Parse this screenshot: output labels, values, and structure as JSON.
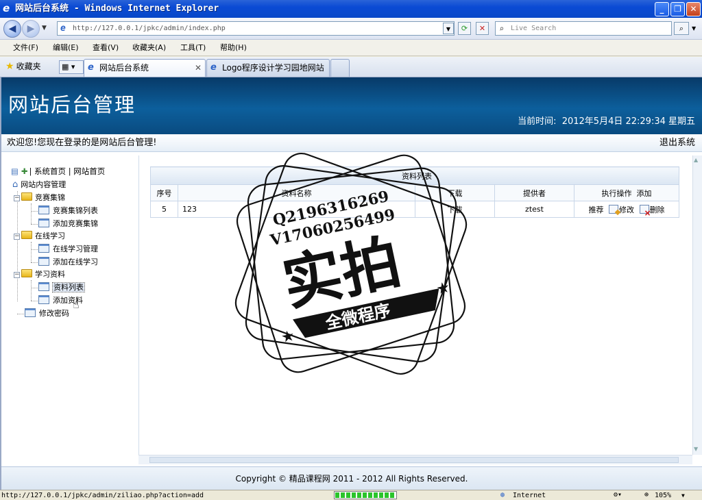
{
  "window": {
    "title": "网站后台系统 - Windows Internet Explorer",
    "controls": {
      "minimize": "_",
      "maximize": "❐",
      "close": "✕"
    }
  },
  "address_bar": {
    "url": "http://127.0.0.1/jpkc/admin/index.php",
    "search_placeholder": "Live Search"
  },
  "menu": [
    "文件(F)",
    "编辑(E)",
    "查看(V)",
    "收藏夹(A)",
    "工具(T)",
    "帮助(H)"
  ],
  "tabs": {
    "favorites_label": "收藏夹",
    "items": [
      {
        "label": "网站后台系统",
        "active": true
      },
      {
        "label": "Logo程序设计学习园地网站",
        "active": false
      }
    ]
  },
  "page": {
    "site_title": "网站后台管理",
    "time_label": "当前时间:",
    "time_value": "2012年5月4日 22:29:34 星期五",
    "welcome": "欢迎您!您现在登录的是网站后台管理!",
    "logout": "退出系统",
    "sidebar": {
      "top_links": "| 系统首页 | 网站首页",
      "root": "网站内容管理",
      "groups": [
        {
          "label": "竞赛集锦",
          "children": [
            "竞赛集锦列表",
            "添加竞赛集锦"
          ]
        },
        {
          "label": "在线学习",
          "children": [
            "在线学习管理",
            "添加在线学习"
          ]
        },
        {
          "label": "学习资料",
          "children": [
            "资料列表",
            "添加资料"
          ]
        }
      ],
      "change_password": "修改密码"
    },
    "table": {
      "caption": "资料列表",
      "headers": [
        "序号",
        "资料名称",
        "下载",
        "提供者",
        "执行操作",
        "添加"
      ],
      "rows": [
        {
          "id": "5",
          "name": "123",
          "download": "下载",
          "provider": "ztest",
          "recommend": "推荐",
          "edit": "修改",
          "delete": "删除"
        }
      ]
    },
    "footer": "Copyright © 精品课程网 2011 - 2012 All Rights Reserved."
  },
  "watermark": {
    "line1": "Q2196316269",
    "line2": "V17060256499",
    "big": "实拍",
    "ribbon": "全微程序"
  },
  "status_bar": {
    "url": "http://127.0.0.1/jpkc/admin/ziliao.php?action=add",
    "zone": "Internet",
    "zoom": "105%",
    "progress": 1.0
  }
}
